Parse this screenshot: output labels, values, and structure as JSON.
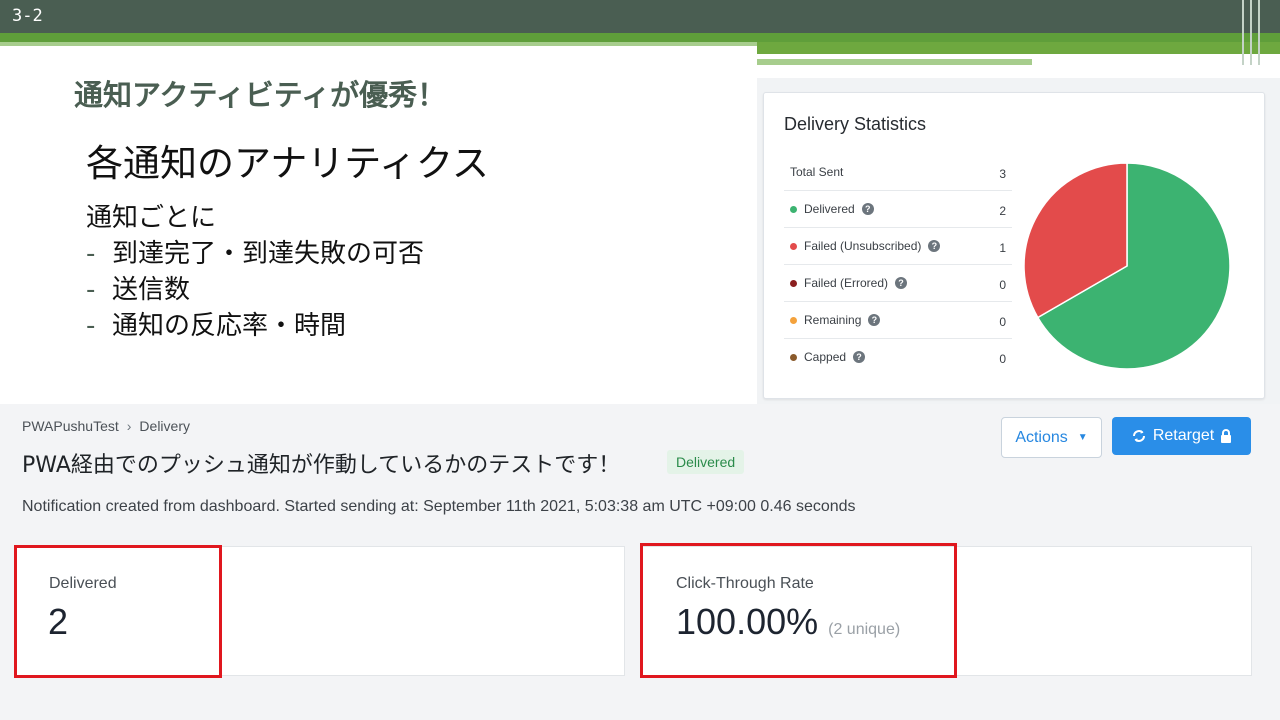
{
  "slide": {
    "number": "3-2",
    "subtitle": "通知アクティビティが優秀！",
    "heading": "各通知のアナリティクス",
    "intro": "通知ごとに",
    "bullets": [
      "到達完了・到達失敗の可否",
      "送信数",
      "通知の反応率・時間"
    ],
    "bullet_marker": "-"
  },
  "delivery_statistics": {
    "title": "Delivery Statistics",
    "rows": [
      {
        "label": "Total Sent",
        "value": "3",
        "dot_color": "",
        "help": false
      },
      {
        "label": "Delivered",
        "value": "2",
        "dot_color": "#3cb371",
        "help": true
      },
      {
        "label": "Failed (Unsubscribed)",
        "value": "1",
        "dot_color": "#e34b4b",
        "help": true
      },
      {
        "label": "Failed (Errored)",
        "value": "0",
        "dot_color": "#8b1f1f",
        "help": true
      },
      {
        "label": "Remaining",
        "value": "0",
        "dot_color": "#f4a23c",
        "help": true
      },
      {
        "label": "Capped",
        "value": "0",
        "dot_color": "#8a5a2b",
        "help": true
      }
    ],
    "help_glyph": "?"
  },
  "chart_data": {
    "type": "pie",
    "categories": [
      "Delivered",
      "Failed (Unsubscribed)"
    ],
    "values": [
      2,
      1
    ],
    "colors": [
      "#3cb371",
      "#e34b4b"
    ]
  },
  "dashboard": {
    "breadcrumb": [
      "PWAPushuTest",
      "Delivery"
    ],
    "breadcrumb_separator": "›",
    "title": "PWA経由でのプッシュ通知が作動しているかのテストです！",
    "status_badge": "Delivered",
    "actions_label": "Actions",
    "actions_caret": "▼",
    "retarget_label": "Retarget",
    "description": "Notification created from dashboard. Started sending at: September 11th 2021, 5:03:38 am UTC +09:00 0.46 seconds",
    "metrics": [
      {
        "label": "Delivered",
        "value": "2",
        "sub": ""
      },
      {
        "label": "Click-Through Rate",
        "value": "100.00%",
        "sub": "(2 unique)"
      }
    ]
  },
  "colors": {
    "accent_blue": "#2a8ee8",
    "highlight_red": "#e0171e",
    "slide_green": "#4a5e52"
  }
}
